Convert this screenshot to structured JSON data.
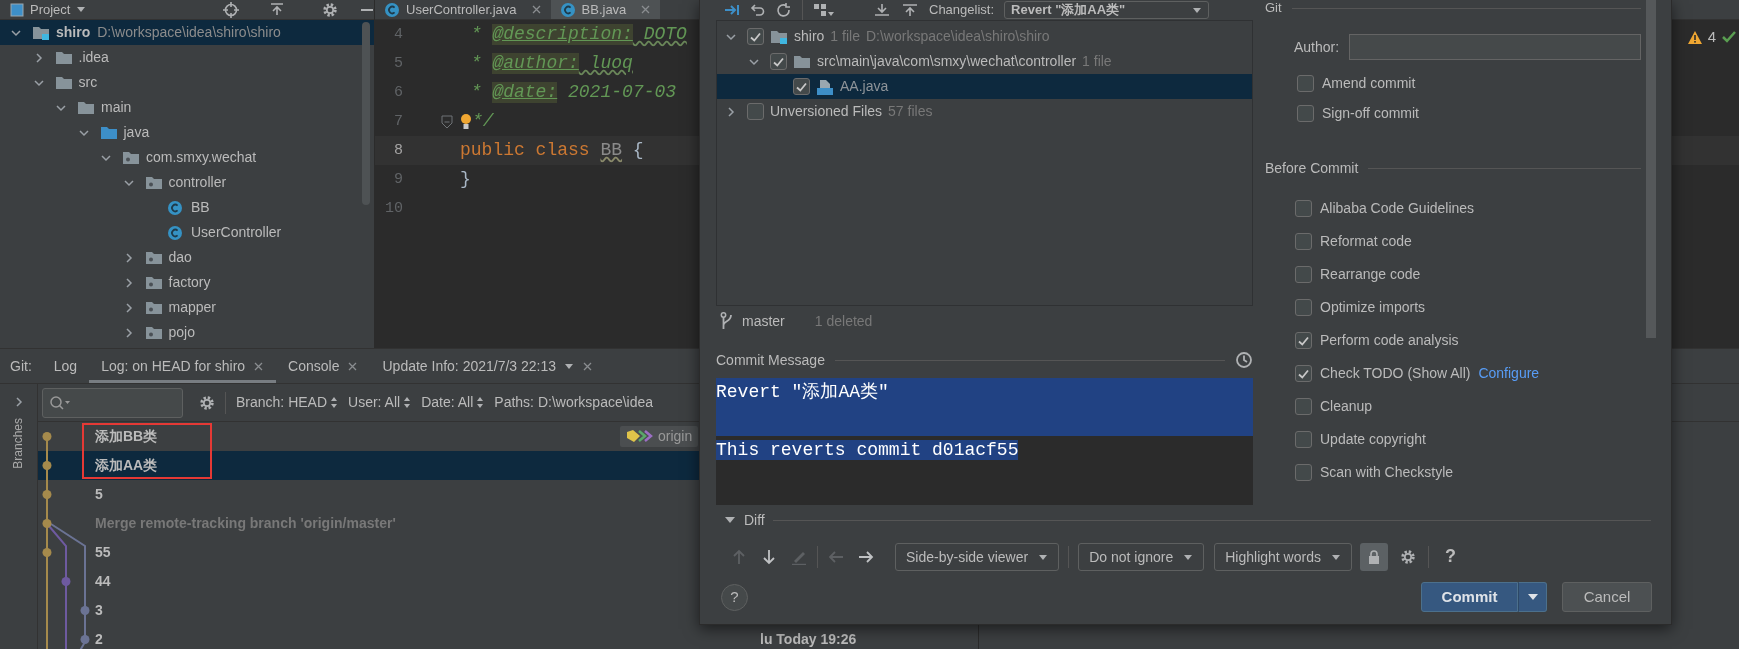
{
  "project_panel": {
    "title": "Project",
    "tree": [
      {
        "label": "shiro",
        "hint": "D:\\workspace\\idea\\shiro\\shiro",
        "kind": "module",
        "expanded": true,
        "selected": true,
        "children": [
          {
            "label": ".idea",
            "kind": "folder",
            "expanded": false,
            "selected": false
          },
          {
            "label": "src",
            "kind": "folder",
            "expanded": true,
            "selected": false,
            "children": [
              {
                "label": "main",
                "kind": "folder",
                "expanded": true,
                "selected": false,
                "children": [
                  {
                    "label": "java",
                    "kind": "source_root",
                    "expanded": true,
                    "selected": false,
                    "children": [
                      {
                        "label": "com.smxy.wechat",
                        "kind": "package",
                        "expanded": true,
                        "selected": false,
                        "children": [
                          {
                            "label": "controller",
                            "kind": "package",
                            "expanded": true,
                            "selected": false,
                            "children": [
                              {
                                "label": "BB",
                                "kind": "class",
                                "selected": false
                              },
                              {
                                "label": "UserController",
                                "kind": "class",
                                "selected": false
                              }
                            ]
                          },
                          {
                            "label": "dao",
                            "kind": "package",
                            "expanded": false,
                            "selected": false
                          },
                          {
                            "label": "factory",
                            "kind": "package",
                            "expanded": false,
                            "selected": false
                          },
                          {
                            "label": "mapper",
                            "kind": "package",
                            "expanded": false,
                            "selected": false
                          },
                          {
                            "label": "pojo",
                            "kind": "package",
                            "expanded": false,
                            "selected": false
                          }
                        ]
                      }
                    ]
                  }
                ]
              }
            ]
          }
        ]
      }
    ]
  },
  "editor": {
    "tabs": [
      {
        "label": "UserController.java",
        "selected": false
      },
      {
        "label": "BB.java",
        "selected": true
      }
    ],
    "warnings": "4",
    "lines": [
      {
        "number": "4",
        "current": false,
        "tokens": [
          {
            "text": " * ",
            "kind": "comment"
          },
          {
            "text": "@description:",
            "kind": "doc_tag"
          },
          {
            "text": " DOTO",
            "kind": "typo"
          }
        ]
      },
      {
        "number": "5",
        "current": false,
        "tokens": [
          {
            "text": " * ",
            "kind": "comment"
          },
          {
            "text": "@author:",
            "kind": "doc_tag"
          },
          {
            "text": " luoq",
            "kind": "typo"
          }
        ]
      },
      {
        "number": "6",
        "current": false,
        "tokens": [
          {
            "text": " * ",
            "kind": "comment"
          },
          {
            "text": "@date:",
            "kind": "doc_tag"
          },
          {
            "text": " 2021-07-03",
            "kind": "comment"
          }
        ]
      },
      {
        "number": "7",
        "current": false,
        "fold_marker": true,
        "intention": true,
        "tokens": [
          {
            "text": "*/",
            "kind": "comment"
          }
        ]
      },
      {
        "number": "8",
        "current": true,
        "tokens": [
          {
            "text": "public class ",
            "kind": "keyword"
          },
          {
            "text": "BB",
            "kind": "unused"
          },
          {
            "text": " {",
            "kind": "plain"
          }
        ]
      },
      {
        "number": "9",
        "current": false,
        "tokens": [
          {
            "text": "}",
            "kind": "plain"
          }
        ]
      },
      {
        "number": "10",
        "current": false
      }
    ]
  },
  "log_panel": {
    "title": "Git:",
    "tabs": [
      {
        "label": "Log",
        "closable": false,
        "dropdown": false,
        "selected": false
      },
      {
        "label": "Log: on HEAD for shiro",
        "closable": true,
        "dropdown": false,
        "selected": true
      },
      {
        "label": "Console",
        "closable": true,
        "dropdown": false,
        "selected": false
      },
      {
        "label": "Update Info: 2021/7/3 22:13",
        "closable": true,
        "dropdown": true,
        "selected": false
      }
    ],
    "side_label": "Branches",
    "filters": [
      "Branch: HEAD",
      "User: All",
      "Date: All"
    ],
    "paths": "Paths: D:\\workspace\\idea",
    "commits": [
      {
        "message": "添加BB类",
        "kind": "normal",
        "selected": false,
        "marked": true,
        "tag": "origin"
      },
      {
        "message": "添加AA类",
        "kind": "normal",
        "selected": true,
        "marked": true
      },
      {
        "message": "5",
        "kind": "normal",
        "selected": false,
        "marked": false
      },
      {
        "message": "Merge remote-tracking branch 'origin/master'",
        "kind": "merge",
        "selected": false,
        "marked": false
      },
      {
        "message": "55",
        "kind": "normal",
        "selected": false,
        "marked": false
      },
      {
        "message": "44",
        "kind": "normal",
        "selected": false,
        "marked": false
      },
      {
        "message": "3",
        "kind": "normal",
        "selected": false,
        "marked": false
      },
      {
        "message": "2",
        "kind": "normal",
        "selected": false,
        "marked": false,
        "author_date": "lu Today 19:26"
      }
    ]
  },
  "commit_dialog": {
    "changelist_label": "Changelist:",
    "changelist": "Revert \"添加AA类\"",
    "changes": [
      {
        "label": "shiro",
        "count": "1 file",
        "hint": "D:\\workspace\\idea\\shiro\\shiro",
        "kind": "module",
        "checked": true,
        "expanded": true,
        "selected": false,
        "children": [
          {
            "label": "src\\main\\java\\com\\smxy\\wechat\\controller",
            "count": "1 file",
            "kind": "folder",
            "checked": true,
            "expanded": true,
            "selected": false,
            "children": [
              {
                "label": "AA.java",
                "kind": "deleted_file",
                "checked": true,
                "selected": true
              }
            ]
          }
        ]
      },
      {
        "label": "Unversioned Files",
        "count": "57 files",
        "kind": "group",
        "checked": false,
        "expanded": false,
        "selected": false
      }
    ],
    "branch": "master",
    "summary": "1 deleted",
    "message_label": "Commit Message",
    "message": {
      "paragraphs": [
        "Revert \"添加AA类\"",
        "This reverts commit d01acf55"
      ],
      "selected": true
    },
    "diff": {
      "title": "Diff",
      "expanded": true,
      "tools": [
        {
          "kind": "up",
          "disabled": true
        },
        {
          "kind": "down",
          "disabled": false
        },
        {
          "kind": "edit",
          "disabled": true
        },
        {
          "kind": "left",
          "disabled": true
        },
        {
          "kind": "right",
          "disabled": false
        }
      ],
      "viewer": "Side-by-side viewer",
      "ignore": "Do not ignore",
      "highlight": "Highlight words",
      "locked": true,
      "help": "?"
    },
    "git": {
      "title": "Git",
      "author_label": "Author:",
      "options": [
        {
          "label": "Amend commit",
          "checked": false
        },
        {
          "label": "Sign-off commit",
          "checked": false
        }
      ]
    },
    "before_commit": {
      "title": "Before Commit",
      "options": [
        {
          "label": "Alibaba Code Guidelines",
          "checked": false
        },
        {
          "label": "Reformat code",
          "checked": false
        },
        {
          "label": "Rearrange code",
          "checked": false
        },
        {
          "label": "Optimize imports",
          "checked": false
        },
        {
          "label": "Perform code analysis",
          "checked": true
        },
        {
          "label": "Check TODO (Show All)",
          "checked": true,
          "link": "Configure"
        },
        {
          "label": "Cleanup",
          "checked": false
        },
        {
          "label": "Update copyright",
          "checked": false
        },
        {
          "label": "Scan with Checkstyle",
          "checked": false
        }
      ]
    },
    "buttons": {
      "help": "?",
      "commit": "Commit",
      "cancel": "Cancel"
    }
  }
}
